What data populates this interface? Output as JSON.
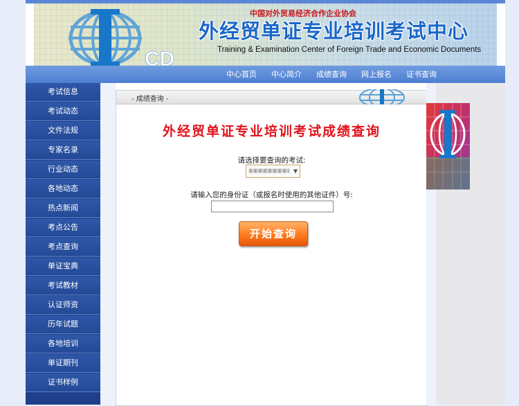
{
  "banner": {
    "org_name": "中国对外贸易经济合作企业协会",
    "center_title": "外经贸单证专业培训考试中心",
    "center_title_en": "Training & Examination Center of Foreign Trade and Economic Documents",
    "logo_text": "ICD"
  },
  "nav": {
    "items": [
      {
        "label": "中心首页"
      },
      {
        "label": "中心简介"
      },
      {
        "label": "成绩查询"
      },
      {
        "label": "网上报名"
      },
      {
        "label": "证书查询"
      }
    ]
  },
  "sidebar": {
    "items": [
      {
        "label": "考试信息"
      },
      {
        "label": "考试动态"
      },
      {
        "label": "文件法规"
      },
      {
        "label": "专家名录"
      },
      {
        "label": "行业动态"
      },
      {
        "label": "各地动态"
      },
      {
        "label": "热点新闻"
      },
      {
        "label": "考点公告"
      },
      {
        "label": "考点查询"
      },
      {
        "label": "单证宝典"
      },
      {
        "label": "考试教材"
      },
      {
        "label": "认证师资"
      },
      {
        "label": "历年试题"
      },
      {
        "label": "各地培训"
      },
      {
        "label": "单证期刊"
      },
      {
        "label": "证书样例"
      }
    ]
  },
  "content": {
    "tab_label": "- 成绩查询 -",
    "query_title": "外经贸单证专业培训考试成绩查询",
    "exam_label": "请选择要查询的考试:",
    "exam_select_value": "",
    "id_label": "请输入您的身份证（或报名时使用的其他证件）号:",
    "id_input_value": "",
    "start_button": "开始查询"
  },
  "colors": {
    "nav_blue": "#4e7fd1",
    "sidebar_blue": "#244a97",
    "title_red": "#e0121a",
    "button_orange": "#ff7a1c",
    "banner_title_blue": "#1a66c8"
  }
}
